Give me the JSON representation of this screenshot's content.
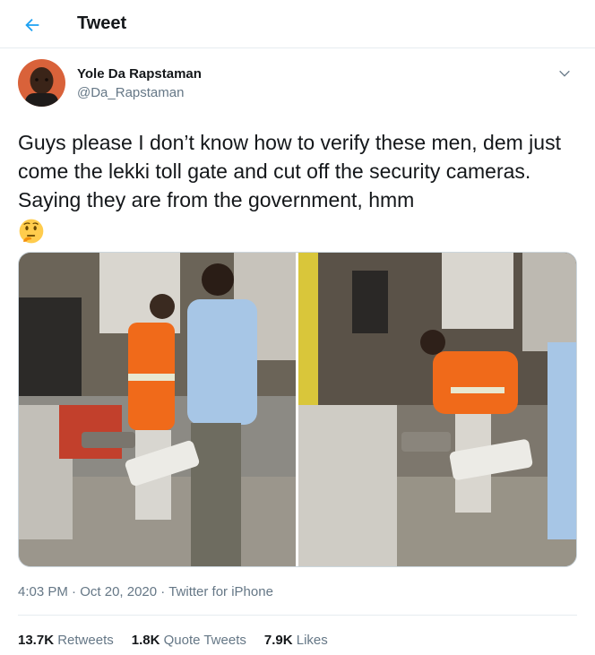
{
  "header": {
    "title": "Tweet"
  },
  "author": {
    "name": "Yole Da Rapstaman",
    "handle": "@Da_Rapstaman"
  },
  "tweet": {
    "text": "Guys please I don’t know how to verify these men, dem just come the lekki toll gate and cut off the security cameras. Saying they are from the government, hmm",
    "emoji": "thinking-face"
  },
  "meta": {
    "time": "4:03 PM",
    "separator": "·",
    "date": "Oct 20, 2020",
    "source": "Twitter for iPhone"
  },
  "stats": {
    "retweets_count": "13.7K",
    "retweets_label": "Retweets",
    "quotes_count": "1.8K",
    "quotes_label": "Quote Tweets",
    "likes_count": "7.9K",
    "likes_label": "Likes"
  },
  "colors": {
    "accent": "#1da1f2",
    "text": "#14171a",
    "secondary": "#657786",
    "border": "#e6ecf0"
  },
  "icons": {
    "back": "arrow-left-icon",
    "more": "chevron-down-icon"
  }
}
